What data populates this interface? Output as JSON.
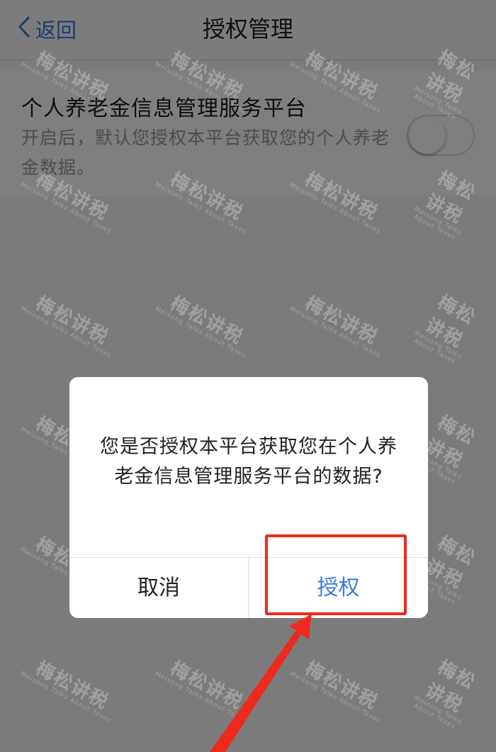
{
  "nav": {
    "back_label": "返回",
    "title": "授权管理"
  },
  "setting": {
    "title": "个人养老金信息管理服务平台",
    "description": "开启后，默认您授权本平台获取您的个人养老金数据。",
    "toggle_on": false
  },
  "dialog": {
    "message": "您是否授权本平台获取您在个人养老金信息管理服务平台的数据?",
    "cancel_label": "取消",
    "confirm_label": "授权"
  },
  "watermark": {
    "text": "梅松讲税",
    "subtext": "Meisong Talks About Taxes"
  },
  "colors": {
    "accent": "#3b7be0",
    "annotation": "#ee2a1e",
    "overlay": "rgba(0,0,0,0.50)"
  },
  "icons": {
    "back": "chevron-left-icon",
    "annotation_arrow": "red-arrow-icon"
  }
}
